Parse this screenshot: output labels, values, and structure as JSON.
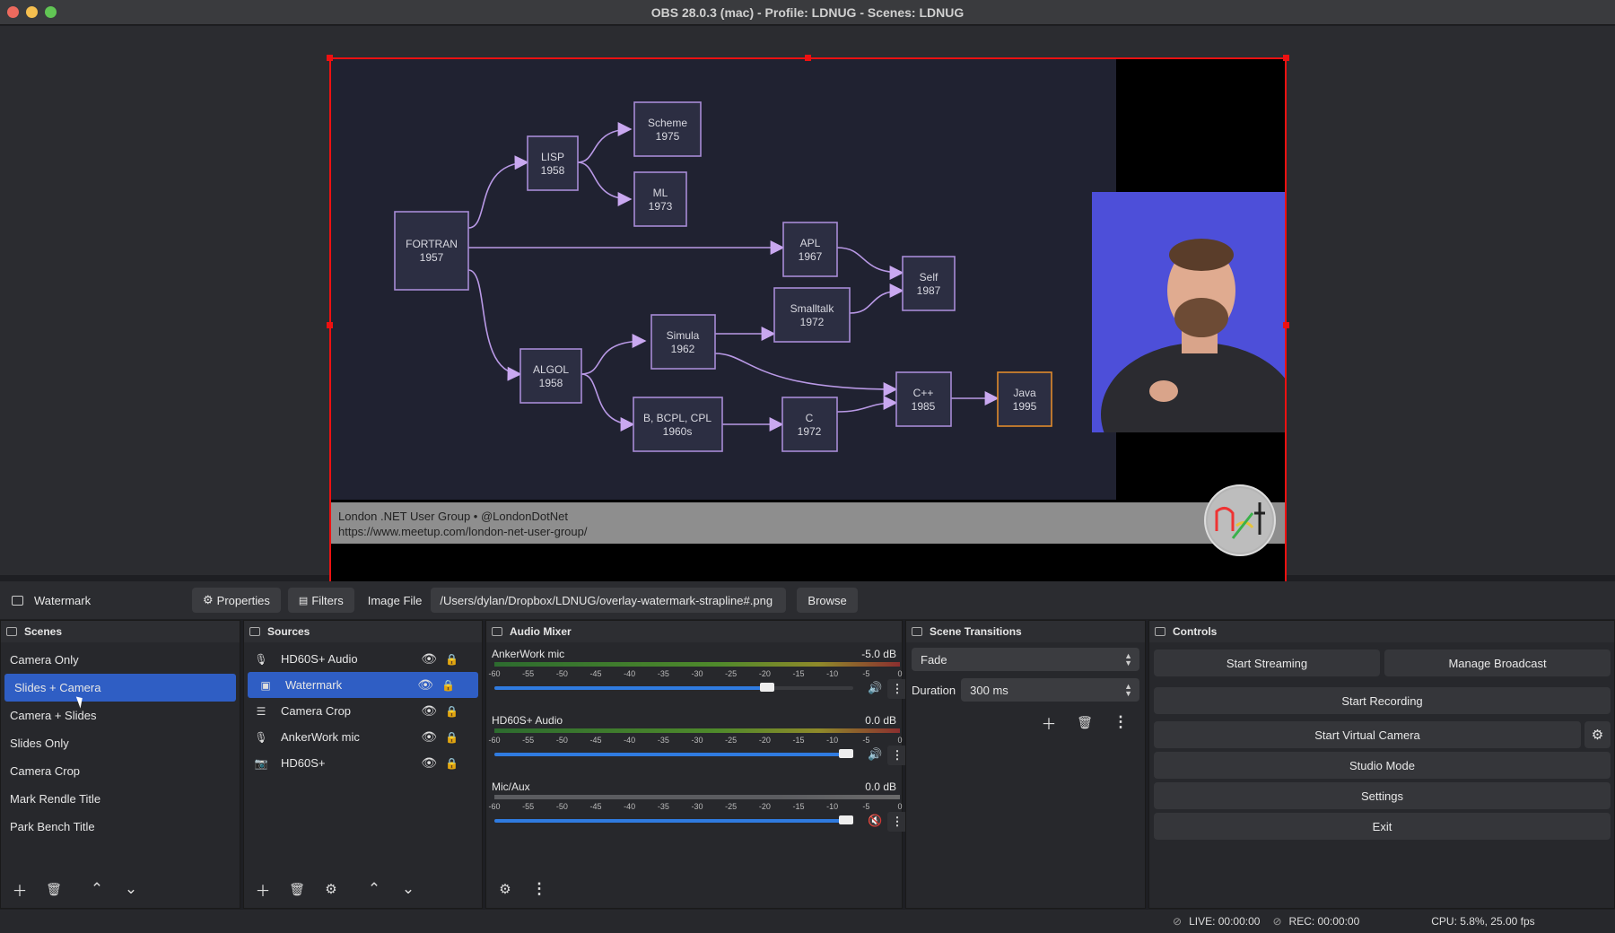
{
  "window": {
    "title": "OBS 28.0.3 (mac) - Profile: LDNUG - Scenes: LDNUG"
  },
  "preview": {
    "diagram_nodes": [
      {
        "label": "FORTRAN",
        "year": "1957"
      },
      {
        "label": "LISP",
        "year": "1958"
      },
      {
        "label": "Scheme",
        "year": "1975"
      },
      {
        "label": "ML",
        "year": "1973"
      },
      {
        "label": "APL",
        "year": "1967"
      },
      {
        "label": "Self",
        "year": "1987"
      },
      {
        "label": "Smalltalk",
        "year": "1972"
      },
      {
        "label": "Simula",
        "year": "1962"
      },
      {
        "label": "ALGOL",
        "year": "1958"
      },
      {
        "label": "B, BCPL, CPL",
        "year": "1960s"
      },
      {
        "label": "C",
        "year": "1972"
      },
      {
        "label": "C++",
        "year": "1985"
      },
      {
        "label": "Java",
        "year": "1995"
      }
    ],
    "strapline_line1": "London .NET User Group • @LondonDotNet",
    "strapline_line2": "https://www.meetup.com/london-net-user-group/"
  },
  "propbar": {
    "source_name": "Watermark",
    "properties_label": "Properties",
    "filters_label": "Filters",
    "image_file_label": "Image File",
    "image_path": "/Users/dylan/Dropbox/LDNUG/overlay-watermark-strapline#.png",
    "browse_label": "Browse"
  },
  "scenes": {
    "title": "Scenes",
    "items": [
      "Camera Only",
      "Slides + Camera",
      "Camera + Slides",
      "Slides Only",
      "Camera Crop",
      "Mark Rendle Title",
      "Park Bench Title"
    ],
    "selected": "Slides + Camera"
  },
  "sources": {
    "title": "Sources",
    "items": [
      {
        "name": "HD60S+ Audio",
        "icon": "microphone-icon"
      },
      {
        "name": "Watermark",
        "icon": "image-icon"
      },
      {
        "name": "Camera Crop",
        "icon": "list-icon"
      },
      {
        "name": "AnkerWork mic",
        "icon": "microphone-icon"
      },
      {
        "name": "HD60S+",
        "icon": "camera-icon"
      }
    ],
    "selected": "Watermark"
  },
  "mixer": {
    "title": "Audio Mixer",
    "scale": [
      "-60",
      "-55",
      "-50",
      "-45",
      "-40",
      "-35",
      "-30",
      "-25",
      "-20",
      "-15",
      "-10",
      "-5",
      "0"
    ],
    "tracks": [
      {
        "name": "AnkerWork mic",
        "db": "-5.0 dB",
        "level": 0.78,
        "muted": false
      },
      {
        "name": "HD60S+ Audio",
        "db": "0.0 dB",
        "level": 1.0,
        "muted": false
      },
      {
        "name": "Mic/Aux",
        "db": "0.0 dB",
        "level": 1.0,
        "muted": true
      }
    ]
  },
  "transitions": {
    "title": "Scene Transitions",
    "selected": "Fade",
    "duration_label": "Duration",
    "duration_value": "300 ms"
  },
  "controls": {
    "title": "Controls",
    "start_streaming": "Start Streaming",
    "manage_broadcast": "Manage Broadcast",
    "start_recording": "Start Recording",
    "start_virtual_camera": "Start Virtual Camera",
    "studio_mode": "Studio Mode",
    "settings": "Settings",
    "exit": "Exit"
  },
  "status": {
    "live": "LIVE: 00:00:00",
    "rec": "REC: 00:00:00",
    "cpu": "CPU: 5.8%, 25.00 fps"
  },
  "colors": {
    "accent": "#2f5ec4",
    "selection_border": "#ee1111",
    "diagram_bg": "#202231",
    "node_border": "#a78bd6",
    "java_border": "#e08a2c"
  }
}
